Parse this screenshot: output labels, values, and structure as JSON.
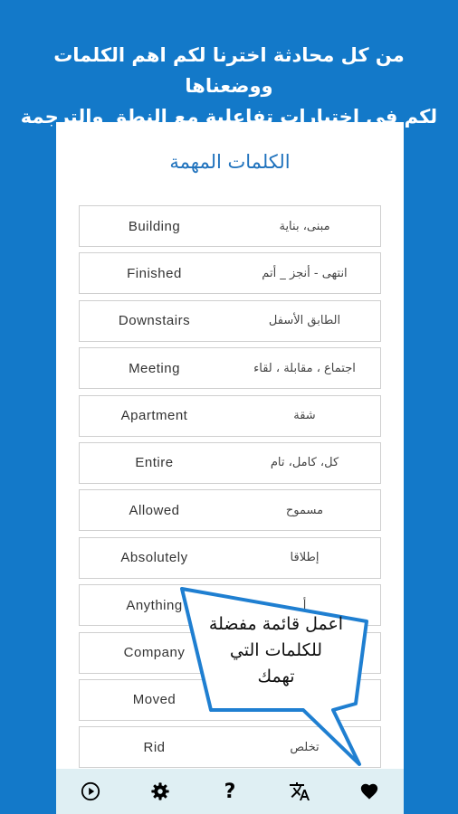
{
  "promo": {
    "line1": "من كل محادثة اخترنا لكم اهم الكلمات ووضعناها",
    "line2": "لكم في اختبارات تفاعلية مع النطق والترجمة"
  },
  "screen": {
    "title": "الكلمات المهمة",
    "words": [
      {
        "en": "Building",
        "ar": "مبنى، بناية"
      },
      {
        "en": "Finished",
        "ar": "انتهى - أنجز _ أتم"
      },
      {
        "en": "Downstairs",
        "ar": "الطابق الأسفل"
      },
      {
        "en": "Meeting",
        "ar": "اجتماع ، مقابلة ، لقاء"
      },
      {
        "en": "Apartment",
        "ar": "شقة"
      },
      {
        "en": "Entire",
        "ar": "كل، كامل، تام"
      },
      {
        "en": "Allowed",
        "ar": "مسموح"
      },
      {
        "en": "Absolutely",
        "ar": "إطلاقا"
      },
      {
        "en": "Anything",
        "ar": "أ"
      },
      {
        "en": "Company",
        "ar": ""
      },
      {
        "en": "Moved",
        "ar": ""
      },
      {
        "en": "Rid",
        "ar": "تخلص"
      }
    ]
  },
  "callout": {
    "line1": "اعمل قائمة مفضلة",
    "line2": "للكلمات التي",
    "line3": "تهمك"
  },
  "navbar": {
    "icons": [
      "play-icon",
      "gear-icon",
      "help-icon",
      "translate-icon",
      "heart-icon"
    ],
    "help_label": "?"
  },
  "colors": {
    "background": "#1379c9",
    "title": "#1f72bd",
    "navbar": "#dfeff3",
    "bubble_border": "#1f7fd1"
  }
}
